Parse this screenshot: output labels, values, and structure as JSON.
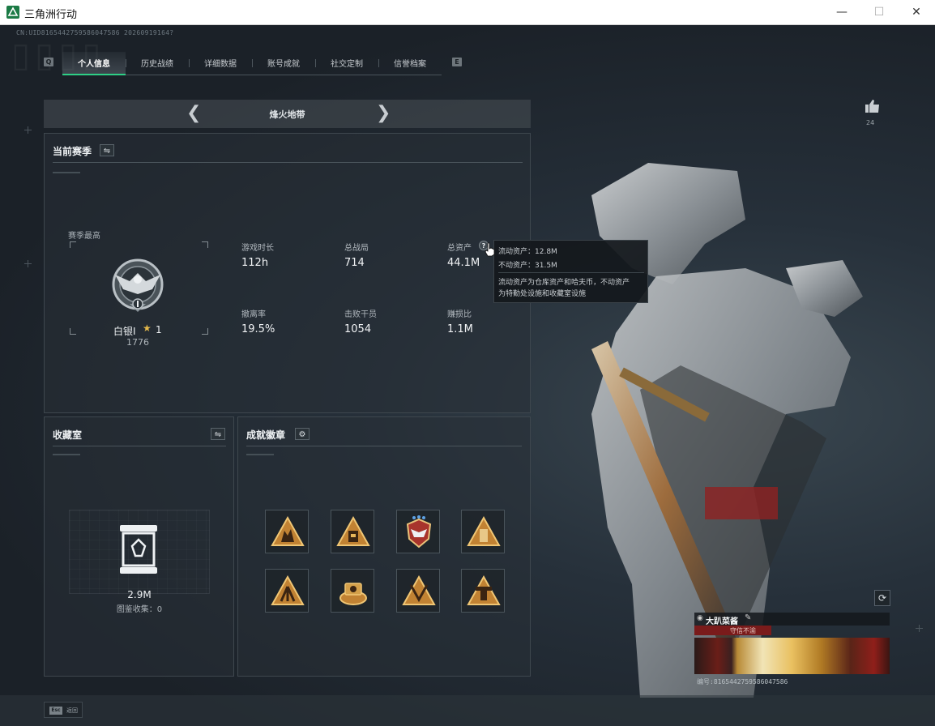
{
  "window": {
    "title": "三角洲行动"
  },
  "uid": "CN:UID8165442759586047586 20260919164?",
  "tabs": [
    {
      "label": "个人信息",
      "active": true
    },
    {
      "label": "历史战绩",
      "active": false
    },
    {
      "label": "详细数据",
      "active": false
    },
    {
      "label": "账号成就",
      "active": false
    },
    {
      "label": "社交定制",
      "active": false
    },
    {
      "label": "信誉档案",
      "active": false
    }
  ],
  "tab_nav": {
    "prev_key": "Q",
    "next_key": "E"
  },
  "mode": {
    "title": "烽火地带"
  },
  "season": {
    "title": "当前赛季",
    "best_label": "赛季最高",
    "rank_name": "白银Ⅰ",
    "rank_stars": "1",
    "rank_score": "1776",
    "stats": [
      {
        "label": "游戏时长",
        "value": "112h"
      },
      {
        "label": "总战局",
        "value": "714"
      },
      {
        "label": "总资产",
        "value": "44.1M"
      },
      {
        "label": "撤离率",
        "value": "19.5%"
      },
      {
        "label": "击败干员",
        "value": "1054"
      },
      {
        "label": "赚损比",
        "value": "1.1M"
      }
    ]
  },
  "tooltip": {
    "liquid": "流动资产：12.8M",
    "fixed": "不动资产：31.5M",
    "desc_line1": "流动资产为仓库资产和哈夫币，不动资产",
    "desc_line2": "为特勤处设施和收藏室设施"
  },
  "collection": {
    "title": "收藏室",
    "value": "2.9M",
    "sub": "图鉴收集：0"
  },
  "achievements": {
    "title": "成就徽章",
    "badges": [
      {
        "icon": "triangle-soldiers-icon"
      },
      {
        "icon": "triangle-building-icon"
      },
      {
        "icon": "eagle-shield-icon"
      },
      {
        "icon": "triangle-tower-icon"
      },
      {
        "icon": "triangle-tripod-icon"
      },
      {
        "icon": "cash-stack-icon"
      },
      {
        "icon": "triangle-blades-icon"
      },
      {
        "icon": "triangle-turret-icon"
      }
    ]
  },
  "likes": {
    "count": "24"
  },
  "card": {
    "name": "大趴菜酱",
    "tag": "守信不渝",
    "id": "编号:8165442759586047586"
  },
  "esc": {
    "key": "Esc",
    "label": "返回"
  },
  "colors": {
    "accent": "#2ecf86",
    "gold": "#e5b94b",
    "badge_red": "#7a1b1b"
  }
}
